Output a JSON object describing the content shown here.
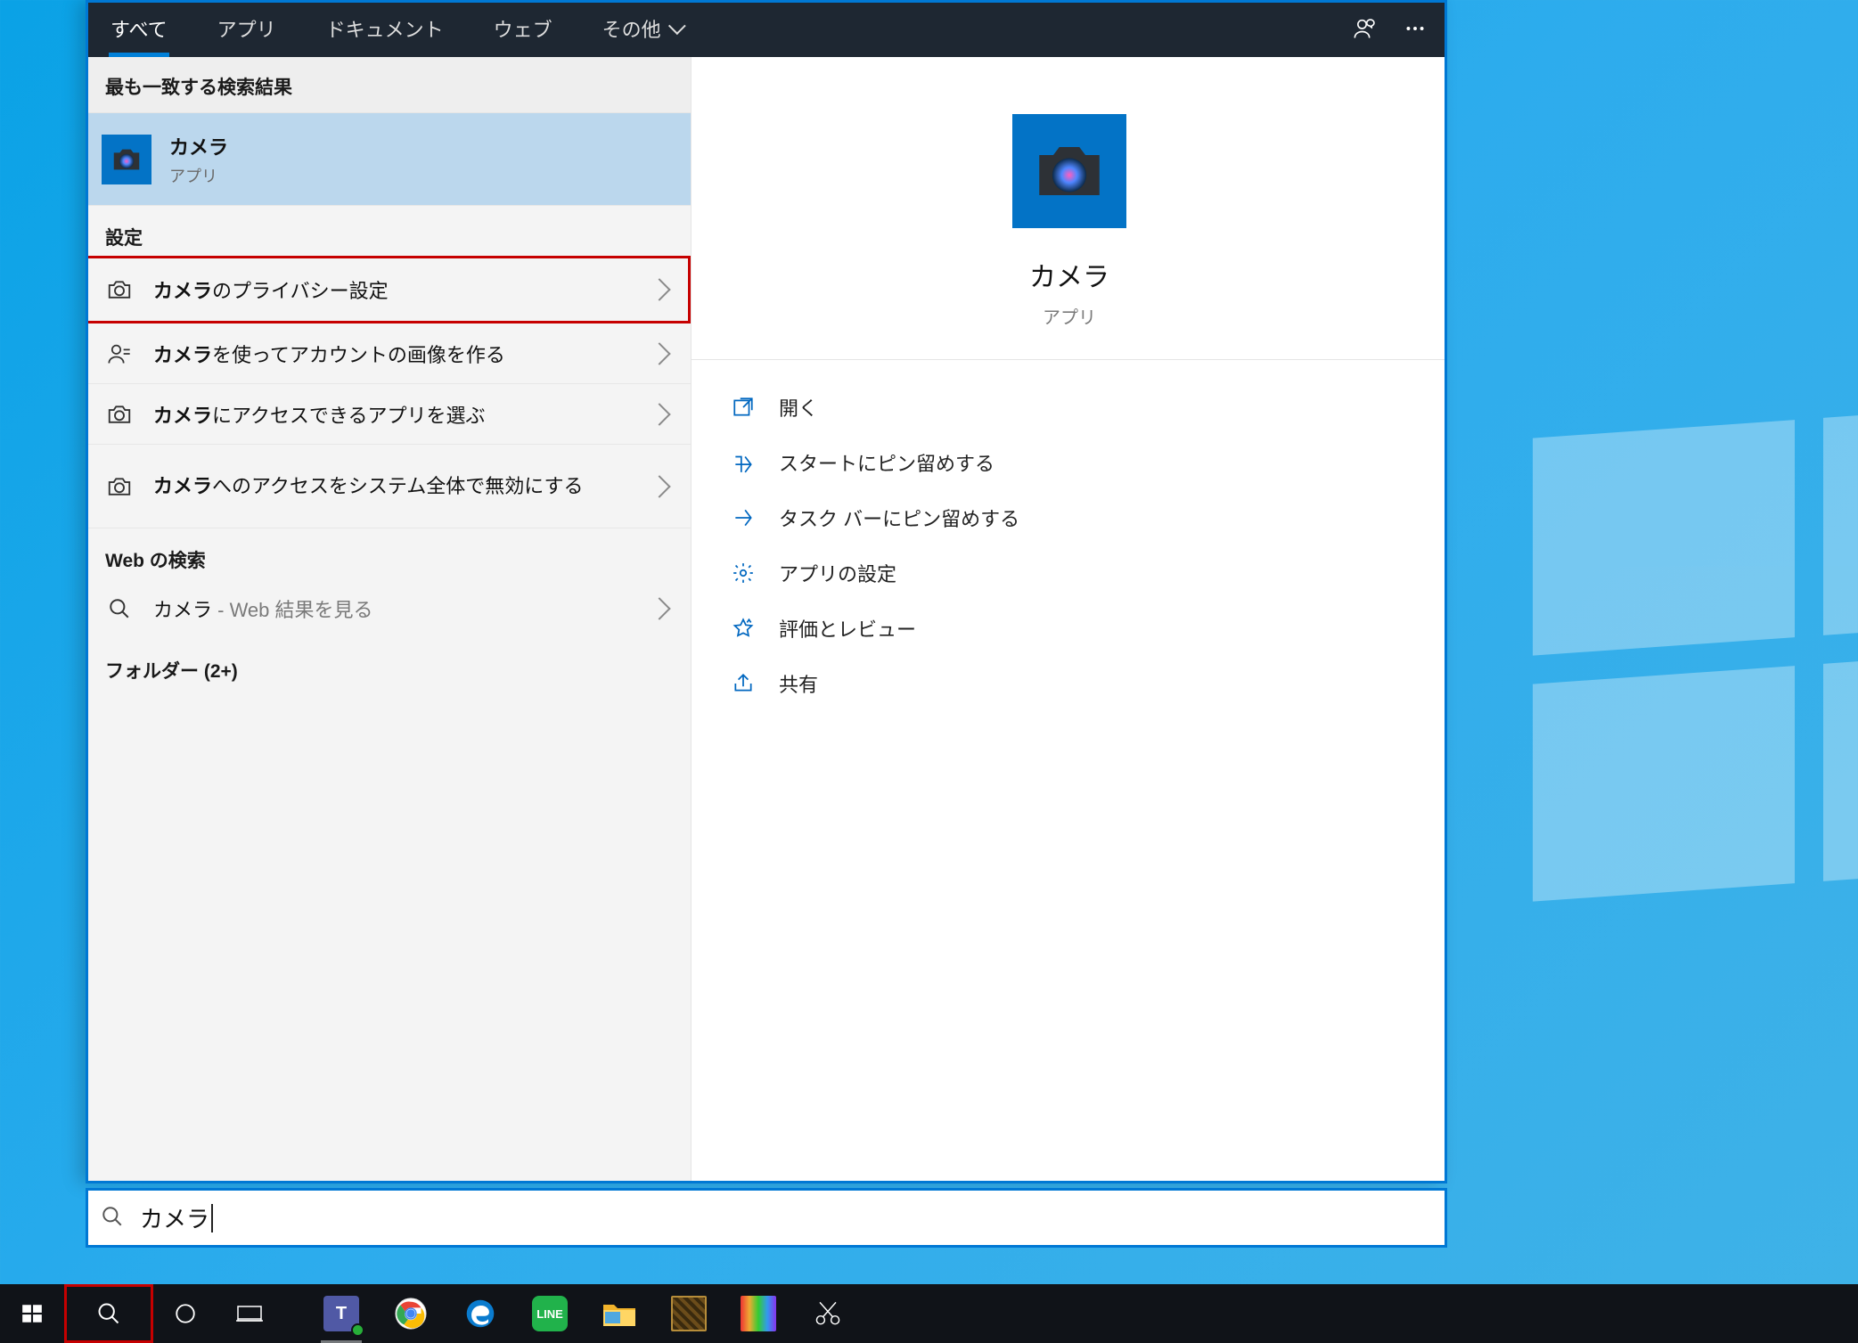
{
  "header": {
    "tabs": [
      "すべて",
      "アプリ",
      "ドキュメント",
      "ウェブ",
      "その他"
    ],
    "active_tab_index": 0
  },
  "results": {
    "best_match_header": "最も一致する検索結果",
    "best_match": {
      "title": "カメラ",
      "subtitle": "アプリ"
    },
    "settings_header": "設定",
    "settings_items": [
      {
        "bold": "カメラ",
        "rest": "のプライバシー設定",
        "icon": "camera-icon",
        "highlight": true
      },
      {
        "bold": "カメラ",
        "rest": "を使ってアカウントの画像を作る",
        "icon": "user-icon",
        "highlight": false
      },
      {
        "bold": "カメラ",
        "rest": "にアクセスできるアプリを選ぶ",
        "icon": "camera-icon",
        "highlight": false
      },
      {
        "bold": "カメラ",
        "rest": "へのアクセスをシステム全体で無効にする",
        "icon": "camera-icon",
        "highlight": false
      }
    ],
    "web_header": "Web の検索",
    "web_item": {
      "title": "カメラ",
      "suffix": " - Web 結果を見る"
    },
    "folder_header": "フォルダー (2+)"
  },
  "preview": {
    "title": "カメラ",
    "subtitle": "アプリ",
    "actions": [
      {
        "icon": "open-icon",
        "label": "開く"
      },
      {
        "icon": "pin-start-icon",
        "label": "スタートにピン留めする"
      },
      {
        "icon": "pin-taskbar-icon",
        "label": "タスク バーにピン留めする"
      },
      {
        "icon": "settings-gear-icon",
        "label": "アプリの設定"
      },
      {
        "icon": "star-icon",
        "label": "評価とレビュー"
      },
      {
        "icon": "share-icon",
        "label": "共有"
      }
    ]
  },
  "search_box": {
    "value": "カメラ"
  },
  "taskbar": {
    "system": [
      "start",
      "search",
      "cortana",
      "task-view"
    ],
    "apps": [
      "teams",
      "chrome",
      "edge",
      "line",
      "explorer",
      "mystery1",
      "mystery2",
      "snip"
    ]
  }
}
